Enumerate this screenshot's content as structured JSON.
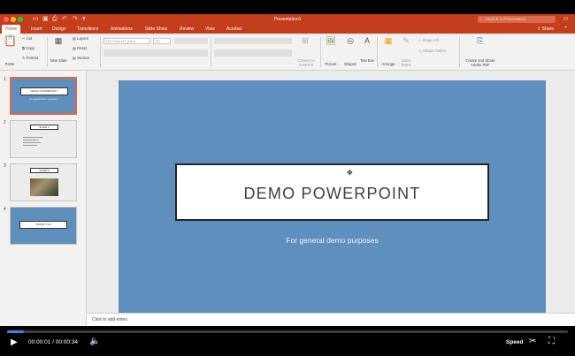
{
  "window": {
    "title": "Presentation1",
    "search_placeholder": "Search in Presentation"
  },
  "tabs": [
    "Home",
    "Insert",
    "Design",
    "Transitions",
    "Animations",
    "Slide Show",
    "Review",
    "View",
    "Acrobat"
  ],
  "share_label": "Share",
  "ribbon": {
    "paste": "Paste",
    "cut": "Cut",
    "copy": "Copy",
    "format": "Format",
    "new_slide": "New Slide",
    "layout": "Layout",
    "reset": "Reset",
    "section": "Section",
    "font_name": "Gill Sans MT (Hea...",
    "font_size": "36",
    "convert_smartart": "Convert to SmartArt",
    "picture": "Picture",
    "shapes": "Shapes",
    "text_box": "Text Box",
    "arrange": "Arrange",
    "quick_styles": "Quick Styles",
    "shape_fill": "Shape Fill",
    "shape_outline": "Shape Outline",
    "create_pdf": "Create and Share Adobe PDF"
  },
  "slides": [
    {
      "num": "1",
      "title": "DEMO POWERPOINT",
      "subtitle": "For general demo purposes"
    },
    {
      "num": "2",
      "title": "SLIDE 1"
    },
    {
      "num": "3",
      "title": "SLIDE 2"
    },
    {
      "num": "4",
      "title": "THANK YOU"
    }
  ],
  "main_slide": {
    "title": "DEMO POWERPOINT",
    "subtitle": "For general demo purposes"
  },
  "notes_placeholder": "Click to add notes",
  "video": {
    "current_time": "00:00:01",
    "separator": "/",
    "duration": "00:00:34",
    "speed_label": "Speed",
    "progress_fraction": 0.03
  },
  "colors": {
    "accent": "#c43e1c",
    "slide_bg": "#5f8fbd",
    "progress": "#2d84f5"
  }
}
